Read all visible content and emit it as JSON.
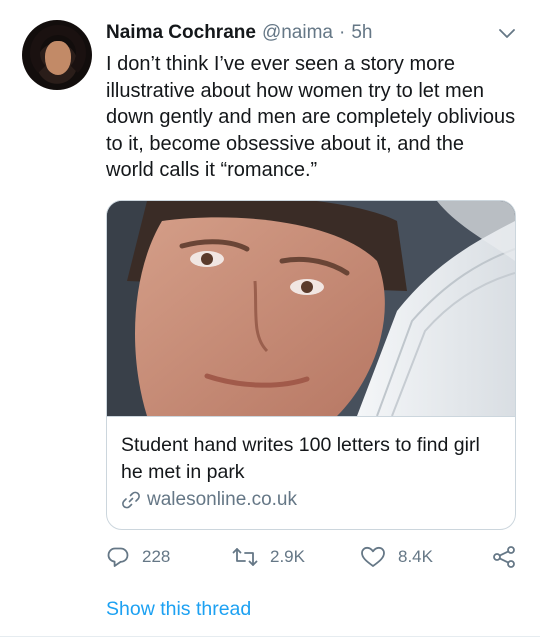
{
  "tweet": {
    "display_name": "Naima Cochrane",
    "handle": "@naima",
    "separator": "·",
    "time": "5h",
    "text": "I don’t think I’ve ever seen a story more illustrative about how women try to let men down gently and men are completely oblivious to it, become obsessive about it, and the world calls it “romance.”",
    "avatar_icon": "profile-photo"
  },
  "card": {
    "image_icon": "article-photo",
    "title": "Student hand writes 100 letters to find girl he met in park",
    "domain": "walesonline.co.uk",
    "link_icon": "link-icon"
  },
  "actions": {
    "reply_count": "228",
    "retweet_count": "2.9K",
    "like_count": "8.4K",
    "reply_icon": "reply-icon",
    "retweet_icon": "retweet-icon",
    "like_icon": "heart-icon",
    "share_icon": "share-icon"
  },
  "footer": {
    "show_thread": "Show this thread"
  },
  "colors": {
    "text": "#14171a",
    "secondary": "#657786",
    "accent": "#1da1f2",
    "border": "#ccd6dd"
  }
}
